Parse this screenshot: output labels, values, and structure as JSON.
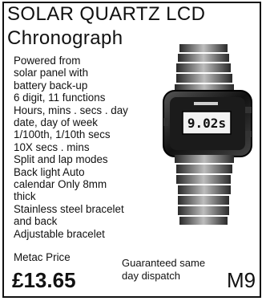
{
  "ad": {
    "title_line1": "SOLAR QUARTZ LCD",
    "title_line2": "Chronograph",
    "features": [
      "Powered from",
      "solar panel with",
      "battery back-up",
      "6 digit, 11 functions",
      "Hours, mins . secs . day",
      "date, day of week",
      "1/100th, 1/10th secs",
      "10X secs . mins",
      "Split and lap modes",
      "Back light Auto",
      "calendar Only 8mm",
      "thick",
      "Stainless steel bracelet",
      "and back",
      "Adjustable bracelet"
    ],
    "price_label": "Metac Price",
    "price": "£13.65",
    "dispatch_line1": "Guaranteed same",
    "dispatch_line2": "day dispatch",
    "code": "M9"
  },
  "watch": {
    "display": "9.02s"
  }
}
